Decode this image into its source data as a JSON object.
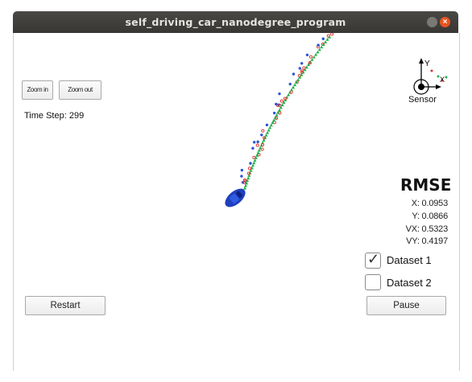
{
  "window": {
    "title": "self_driving_car_nanodegree_program",
    "close_symbol": "×"
  },
  "toolbar": {
    "zoom_in_label": "Zoom in",
    "zoom_out_label": "Zoom out"
  },
  "status": {
    "time_step": "Time Step: 299"
  },
  "sensor": {
    "label": "Sensor",
    "axis_y": "Y",
    "axis_x": "X"
  },
  "rmse": {
    "title": "RMSE",
    "x": "X: 0.0953",
    "y": "Y: 0.0866",
    "vx": "VX: 0.5323",
    "vy": "VY: 0.4197"
  },
  "datasets": [
    {
      "label": "Dataset 1",
      "checked": true
    },
    {
      "label": "Dataset 2",
      "checked": false
    }
  ],
  "controls": {
    "restart_label": "Restart",
    "pause_label": "Pause"
  },
  "colors": {
    "titlebar": "#3e3c39",
    "close_button": "#e95420",
    "car": "#1f3fbf",
    "lidar": "#e03030",
    "radar": "#2a55d6",
    "estimate": "#22b04a"
  },
  "icons": [
    "close-icon",
    "minimize-icon",
    "checkmark-icon",
    "car-icon",
    "sensor-icon"
  ]
}
